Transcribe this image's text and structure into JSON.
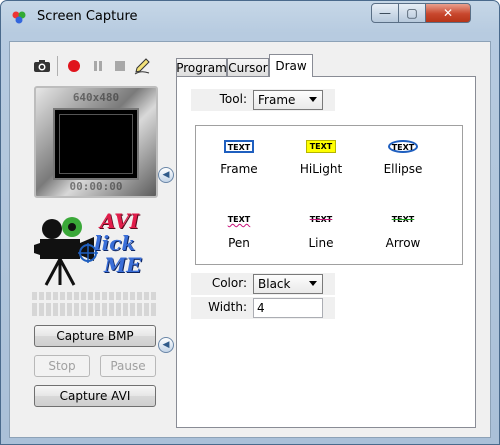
{
  "window": {
    "title": "Screen Capture",
    "minimize_glyph": "—",
    "maximize_glyph": "▢",
    "close_glyph": "✕"
  },
  "preview": {
    "resolution": "640x480",
    "timer": "00:00:00"
  },
  "logo": {
    "line1": "AVI",
    "line2": "lick",
    "line3": "ME"
  },
  "buttons": {
    "capture_bmp": "Capture BMP",
    "stop": "Stop",
    "pause": "Pause",
    "capture_avi": "Capture AVI"
  },
  "tabs": [
    {
      "label": "Program"
    },
    {
      "label": "Cursor"
    },
    {
      "label": "Draw"
    }
  ],
  "draw": {
    "tool_label": "Tool:",
    "tool_value": "Frame",
    "tools": [
      {
        "swatch": "TEXT",
        "name": "Frame"
      },
      {
        "swatch": "TEXT",
        "name": "HiLight"
      },
      {
        "swatch": "TEXT",
        "name": "Ellipse"
      },
      {
        "swatch": "TEXT",
        "name": "Pen"
      },
      {
        "swatch": "TEXT",
        "name": "Line"
      },
      {
        "swatch": "TEXT",
        "name": "Arrow"
      }
    ],
    "color_label": "Color:",
    "color_value": "Black",
    "width_label": "Width:",
    "width_value": "4"
  },
  "colors": {
    "record_red": "#e0141c",
    "highlight_yellow": "#ffff00",
    "frame_blue": "#1f5fbf",
    "pen_magenta": "#c8147a",
    "arrow_green": "#1aa51a"
  }
}
